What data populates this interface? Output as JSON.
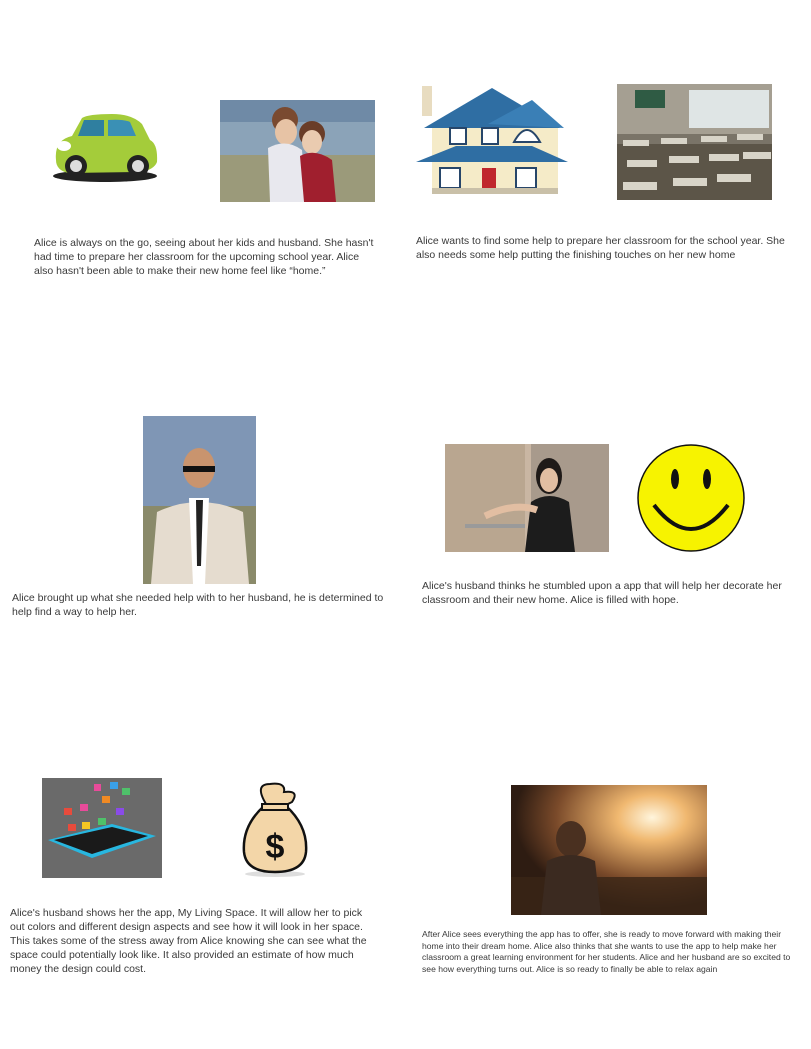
{
  "panels": [
    {
      "images": [
        {
          "icon": "green-car-icon",
          "description_color": "#a4cc3a"
        },
        {
          "icon": "kids-hugging-photo"
        }
      ],
      "caption": "Alice is always on the go, seeing about her kids and husband. She hasn't had time to prepare her classroom for the upcoming school year. Alice also hasn't been able to make their new home feel like “home.”"
    },
    {
      "images": [
        {
          "icon": "house-icon"
        },
        {
          "icon": "classroom-photo"
        }
      ],
      "caption": "Alice wants to find some help to prepare her classroom for the school year. She also needs some help putting the finishing touches on her new home"
    },
    {
      "images": [
        {
          "icon": "husband-photo"
        }
      ],
      "caption": "Alice brought up what she needed help with to her husband, he is determined to help find a way to help her."
    },
    {
      "images": [
        {
          "icon": "woman-photo"
        },
        {
          "icon": "smiley-face-icon"
        }
      ],
      "caption": "Alice's husband thinks he stumbled upon a app that will help her decorate her classroom and their new home. Alice is filled with hope."
    },
    {
      "images": [
        {
          "icon": "phone-apps-icon"
        },
        {
          "icon": "money-bag-icon"
        }
      ],
      "caption": "Alice's husband shows her the app, My Living Space. It will allow her to pick out colors and different design aspects and see how it will look in her space. This takes some of the stress away from Alice knowing she can see what the space could potentially look like. It also provided an estimate of how much money the design could cost."
    },
    {
      "images": [
        {
          "icon": "sunset-woman-photo"
        }
      ],
      "caption": "After Alice sees everything the app has to offer, she is ready to move forward with making their home into their dream home. Alice also thinks that she wants to use the app to help make her classroom a great learning environment for her students. Alice and her husband are so excited to see how everything turns out. Alice is so ready to finally be able to relax again"
    }
  ],
  "colors": {
    "text": "#3a3a3a",
    "car": "#a4cc3a",
    "house_roof": "#2f6ea3",
    "smiley": "#f7f300",
    "money_bag": "#f3d6a8"
  }
}
